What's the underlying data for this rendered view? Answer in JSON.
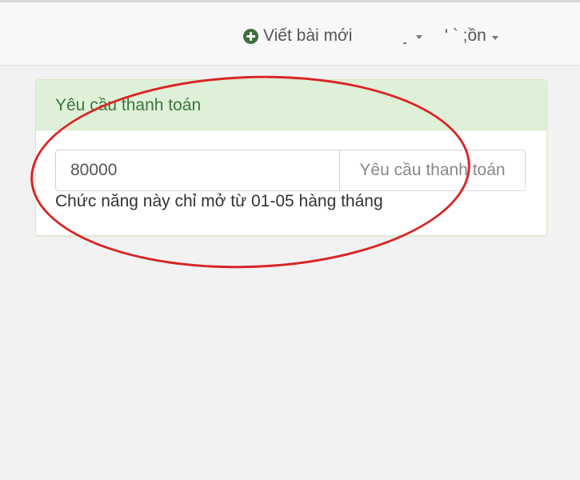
{
  "topbar": {
    "new_post_label": "Viết bài mới",
    "account_label": "' ` ;ồn"
  },
  "icons": {
    "new_post": "plus-circle-icon",
    "account": "chevron-down-icon"
  },
  "colors": {
    "accent": "#3e6f3f",
    "panel_heading_bg": "#dff0d8",
    "panel_heading_text": "#3c763d",
    "annotation": "#d92525"
  },
  "payment_panel": {
    "title": "Yêu cầu thanh toán",
    "amount_value": "80000",
    "submit_label": "Yêu cầu thanh toán",
    "note": "Chức năng này chỉ mở từ 01-05 hàng tháng"
  }
}
